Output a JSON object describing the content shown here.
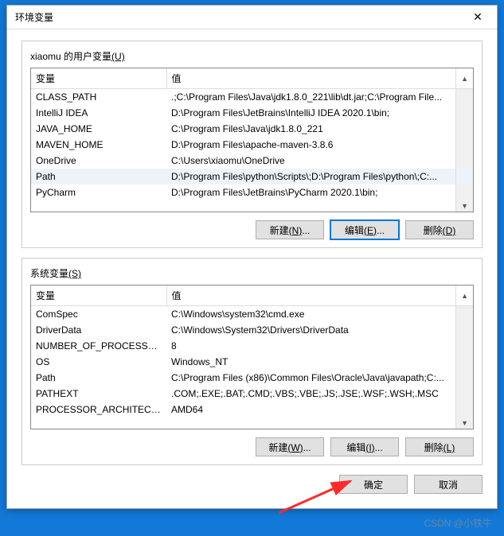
{
  "title": "环境变量",
  "userGroupLabel": "xiaomu 的用户变量",
  "userGroupMnemonic": "(U)",
  "sysGroupLabel": "系统变量",
  "sysGroupMnemonic": "(S)",
  "columns": {
    "var": "变量",
    "val": "值"
  },
  "userVars": [
    {
      "name": "CLASS_PATH",
      "value": ".;C:\\Program Files\\Java\\jdk1.8.0_221\\lib\\dt.jar;C:\\Program File..."
    },
    {
      "name": "IntelliJ IDEA",
      "value": "D:\\Program Files\\JetBrains\\IntelliJ IDEA 2020.1\\bin;"
    },
    {
      "name": "JAVA_HOME",
      "value": "C:\\Program Files\\Java\\jdk1.8.0_221"
    },
    {
      "name": "MAVEN_HOME",
      "value": "D:\\Program Files\\apache-maven-3.8.6"
    },
    {
      "name": "OneDrive",
      "value": "C:\\Users\\xiaomu\\OneDrive"
    },
    {
      "name": "Path",
      "value": "D:\\Program Files\\python\\Scripts\\;D:\\Program Files\\python\\;C:..."
    },
    {
      "name": "PyCharm",
      "value": "D:\\Program Files\\JetBrains\\PyCharm 2020.1\\bin;"
    }
  ],
  "userSelectedIndex": 5,
  "sysVars": [
    {
      "name": "ComSpec",
      "value": "C:\\Windows\\system32\\cmd.exe"
    },
    {
      "name": "DriverData",
      "value": "C:\\Windows\\System32\\Drivers\\DriverData"
    },
    {
      "name": "NUMBER_OF_PROCESSORS",
      "value": "8"
    },
    {
      "name": "OS",
      "value": "Windows_NT"
    },
    {
      "name": "Path",
      "value": "C:\\Program Files (x86)\\Common Files\\Oracle\\Java\\javapath;C:..."
    },
    {
      "name": "PATHEXT",
      "value": ".COM;.EXE;.BAT;.CMD;.VBS;.VBE;.JS;.JSE;.WSF;.WSH;.MSC"
    },
    {
      "name": "PROCESSOR_ARCHITECT...",
      "value": "AMD64"
    }
  ],
  "buttons": {
    "userNew": "新建",
    "userNewMn": "(N)",
    "userEdit": "编辑",
    "userEditMn": "(E)",
    "userDel": "删除",
    "userDelMn": "(D)",
    "sysNew": "新建",
    "sysNewMn": "(W)",
    "sysEdit": "编辑",
    "sysEditMn": "(I)",
    "sysDel": "删除",
    "sysDelMn": "(L)",
    "ok": "确定",
    "cancel": "取消",
    "ellipsis": "..."
  },
  "watermark": "CSDN @小铁牛"
}
